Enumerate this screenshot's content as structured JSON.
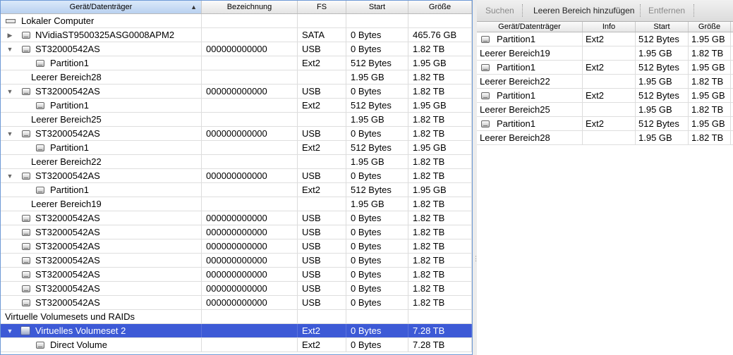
{
  "left_table": {
    "headers": {
      "device": "Gerät/Datenträger",
      "label": "Bezeichnung",
      "fs": "FS",
      "start": "Start",
      "size": "Größe"
    },
    "sort_indicator": "▲",
    "rows": [
      {
        "name": "Lokaler Computer",
        "type": "computer",
        "label": "",
        "fs": "",
        "start": "",
        "size": ""
      },
      {
        "name": "NVidiaST9500325ASG0008APM2",
        "type": "disk",
        "tri": "▶",
        "label": "",
        "fs": "SATA",
        "start": "0 Bytes",
        "size": "465.76 GB"
      },
      {
        "name": "ST32000542AS",
        "type": "disk",
        "tri": "▼",
        "label": "000000000000",
        "fs": "USB",
        "start": "0 Bytes",
        "size": "1.82 TB"
      },
      {
        "name": "Partition1",
        "type": "partition",
        "label": "",
        "fs": "Ext2",
        "start": "512 Bytes",
        "size": "1.95 GB"
      },
      {
        "name": "Leerer Bereich28",
        "type": "free",
        "label": "",
        "fs": "",
        "start": "1.95 GB",
        "size": "1.82 TB"
      },
      {
        "name": "ST32000542AS",
        "type": "disk",
        "tri": "▼",
        "label": "000000000000",
        "fs": "USB",
        "start": "0 Bytes",
        "size": "1.82 TB"
      },
      {
        "name": "Partition1",
        "type": "partition",
        "label": "",
        "fs": "Ext2",
        "start": "512 Bytes",
        "size": "1.95 GB"
      },
      {
        "name": "Leerer Bereich25",
        "type": "free",
        "label": "",
        "fs": "",
        "start": "1.95 GB",
        "size": "1.82 TB"
      },
      {
        "name": "ST32000542AS",
        "type": "disk",
        "tri": "▼",
        "label": "000000000000",
        "fs": "USB",
        "start": "0 Bytes",
        "size": "1.82 TB"
      },
      {
        "name": "Partition1",
        "type": "partition",
        "label": "",
        "fs": "Ext2",
        "start": "512 Bytes",
        "size": "1.95 GB"
      },
      {
        "name": "Leerer Bereich22",
        "type": "free",
        "label": "",
        "fs": "",
        "start": "1.95 GB",
        "size": "1.82 TB"
      },
      {
        "name": "ST32000542AS",
        "type": "disk",
        "tri": "▼",
        "label": "000000000000",
        "fs": "USB",
        "start": "0 Bytes",
        "size": "1.82 TB"
      },
      {
        "name": "Partition1",
        "type": "partition",
        "label": "",
        "fs": "Ext2",
        "start": "512 Bytes",
        "size": "1.95 GB"
      },
      {
        "name": "Leerer Bereich19",
        "type": "free",
        "label": "",
        "fs": "",
        "start": "1.95 GB",
        "size": "1.82 TB"
      },
      {
        "name": "ST32000542AS",
        "type": "disk",
        "label": "000000000000",
        "fs": "USB",
        "start": "0 Bytes",
        "size": "1.82 TB"
      },
      {
        "name": "ST32000542AS",
        "type": "disk",
        "label": "000000000000",
        "fs": "USB",
        "start": "0 Bytes",
        "size": "1.82 TB"
      },
      {
        "name": "ST32000542AS",
        "type": "disk",
        "label": "000000000000",
        "fs": "USB",
        "start": "0 Bytes",
        "size": "1.82 TB"
      },
      {
        "name": "ST32000542AS",
        "type": "disk",
        "label": "000000000000",
        "fs": "USB",
        "start": "0 Bytes",
        "size": "1.82 TB"
      },
      {
        "name": "ST32000542AS",
        "type": "disk",
        "label": "000000000000",
        "fs": "USB",
        "start": "0 Bytes",
        "size": "1.82 TB"
      },
      {
        "name": "ST32000542AS",
        "type": "disk",
        "label": "000000000000",
        "fs": "USB",
        "start": "0 Bytes",
        "size": "1.82 TB"
      },
      {
        "name": "ST32000542AS",
        "type": "disk",
        "label": "000000000000",
        "fs": "USB",
        "start": "0 Bytes",
        "size": "1.82 TB"
      },
      {
        "name": "Virtuelle Volumesets und RAIDs",
        "type": "group",
        "label": "",
        "fs": "",
        "start": "",
        "size": ""
      },
      {
        "name": "Virtuelles Volumeset 2",
        "type": "volume",
        "tri": "▼",
        "selected": true,
        "label": "",
        "fs": "Ext2",
        "start": "0 Bytes",
        "size": "7.28 TB"
      },
      {
        "name": "Direct Volume",
        "type": "partition",
        "label": "",
        "fs": "Ext2",
        "start": "0 Bytes",
        "size": "7.28 TB"
      }
    ]
  },
  "toolbar": {
    "search": "Suchen",
    "add_free": "Leeren Bereich hinzufügen",
    "remove": "Entfernen"
  },
  "right_table": {
    "headers": {
      "device": "Gerät/Datenträger",
      "info": "Info",
      "start": "Start",
      "size": "Größe"
    },
    "rows": [
      {
        "name": "Partition1",
        "type": "partition",
        "info": "Ext2",
        "start": "512 Bytes",
        "size": "1.95 GB"
      },
      {
        "name": "Leerer Bereich19",
        "type": "free",
        "info": "",
        "start": "1.95 GB",
        "size": "1.82 TB"
      },
      {
        "name": "Partition1",
        "type": "partition",
        "info": "Ext2",
        "start": "512 Bytes",
        "size": "1.95 GB"
      },
      {
        "name": "Leerer Bereich22",
        "type": "free",
        "info": "",
        "start": "1.95 GB",
        "size": "1.82 TB"
      },
      {
        "name": "Partition1",
        "type": "partition",
        "info": "Ext2",
        "start": "512 Bytes",
        "size": "1.95 GB"
      },
      {
        "name": "Leerer Bereich25",
        "type": "free",
        "info": "",
        "start": "1.95 GB",
        "size": "1.82 TB"
      },
      {
        "name": "Partition1",
        "type": "partition",
        "info": "Ext2",
        "start": "512 Bytes",
        "size": "1.95 GB"
      },
      {
        "name": "Leerer Bereich28",
        "type": "free",
        "info": "",
        "start": "1.95 GB",
        "size": "1.82 TB"
      }
    ]
  },
  "colors": {
    "selection": "#3d5ad6",
    "pane_border": "#6f9ad6"
  }
}
